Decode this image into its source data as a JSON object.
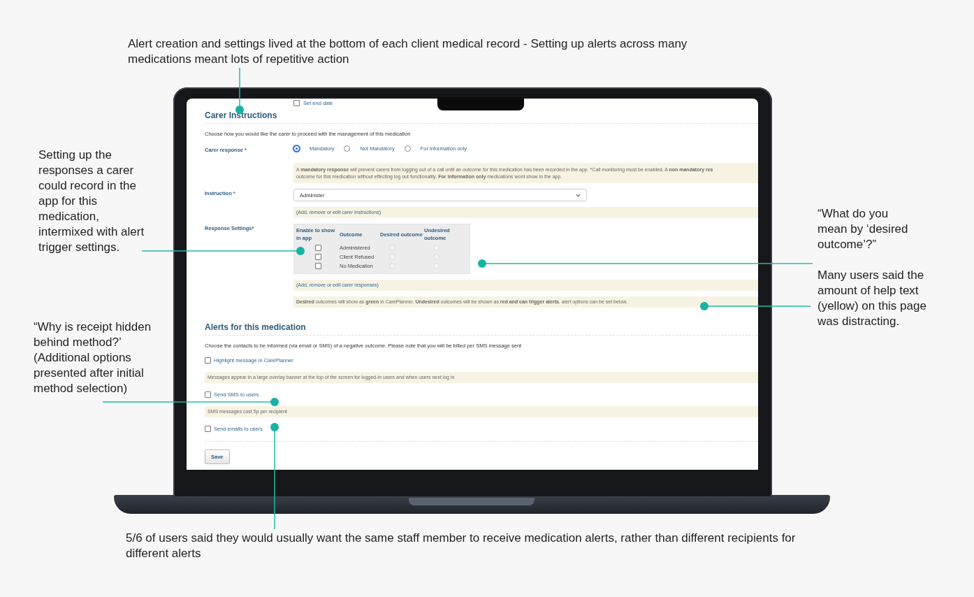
{
  "annotations": [
    {
      "text": "Alert creation and settings lived at the bottom of each client medical record - Setting up alerts across many medications meant lots of repetitive action"
    },
    {
      "text": "Setting up the responses a carer could record in the app for this medication, intermixed with alert trigger settings."
    },
    {
      "text": "“What do you mean by ‘desired outcome’?”"
    },
    {
      "text": "Many users said the amount of help text (yellow) on this page was distracting."
    },
    {
      "text": "“Why is receipt hidden behind method?’ (Additional options presented after initial method selection)"
    },
    {
      "text": "5/6 of users said they would usually want the same staff member to receive medication alerts, rather than different recipients for different alerts"
    }
  ],
  "screen": {
    "end_date": {
      "label": "Set end date",
      "checked": false
    },
    "carer_instructions": {
      "heading": "Carer Instructions",
      "intro": "Choose how you would like the carer to proceed with the management of this medication",
      "response_label": "Carer response *",
      "options": [
        {
          "label": "Mandatory",
          "selected": true
        },
        {
          "label": "Not Mandatory",
          "selected": false
        },
        {
          "label": "For information only",
          "selected": false
        }
      ],
      "help_lines": [
        "A **mandatory response** will prevent carers from logging out of a call until an outcome for this medication has been recorded in the app. *Call monitoring must be enabled. A **non mandatory res**",
        "outcome for this medication without effecting log out functionality. **For information only** medications wont show in the app."
      ],
      "instruction_label": "Instruction *",
      "instruction_value": "Administer",
      "instruction_link": "(Add, remove or edit carer instructions)",
      "settings_label": "Response Settings*",
      "columns": [
        "Enable to show in app",
        "Outcome",
        "Desired outcome",
        "Undesired outcome"
      ],
      "rows": [
        {
          "outcome": "Administered",
          "checked": false,
          "desired": false,
          "undesired": false
        },
        {
          "outcome": "Client Refused",
          "checked": false,
          "desired": false,
          "undesired": false
        },
        {
          "outcome": "No Medication",
          "checked": false,
          "desired": false,
          "undesired": false
        }
      ],
      "responses_link": "(Add, remove or edit carer responses)",
      "outcomes_help": "**Desired** outcomes will show as **green** in CarePlanner. **Undesired** outcomes will be shown as **red and can trigger alerts**, alert options can be set below."
    },
    "alerts": {
      "heading": "Alerts for this medication",
      "intro": "Choose the contacts to be informed (via email or SMS) of a negative outcome. Please note that you will be billed per SMS message sent",
      "options": [
        {
          "label": "Highlight message in CarePlanner",
          "checked": false,
          "help": "Messages appear in a large overlay banner at the top of the screen for logged-in users and when users next log in"
        },
        {
          "label": "Send SMS to users",
          "checked": false,
          "help": "SMS messages cost 5p per recipient"
        },
        {
          "label": "Send emails to users",
          "checked": false
        }
      ],
      "save": "Save"
    }
  }
}
